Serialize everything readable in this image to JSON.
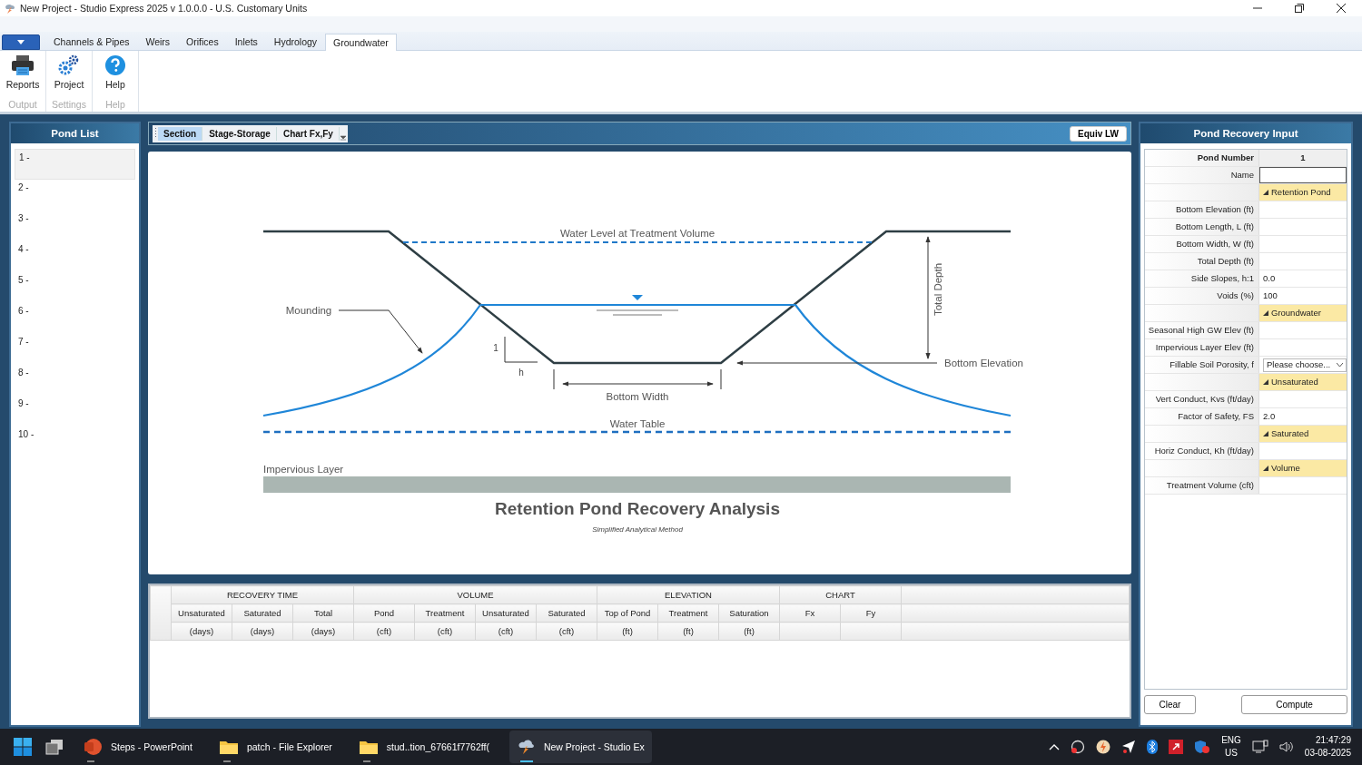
{
  "window": {
    "title": "New Project - Studio Express 2025 v 1.0.0.0 - U.S. Customary Units"
  },
  "ribbon_tabs": [
    {
      "label": "Channels & Pipes",
      "selected": false
    },
    {
      "label": "Weirs",
      "selected": false
    },
    {
      "label": "Orifices",
      "selected": false
    },
    {
      "label": "Inlets",
      "selected": false
    },
    {
      "label": "Hydrology",
      "selected": false
    },
    {
      "label": "Groundwater",
      "selected": true
    }
  ],
  "ribbon_groups": [
    {
      "label": "Output",
      "buttons": [
        {
          "label": "Reports",
          "kind": "printer"
        }
      ]
    },
    {
      "label": "Settings",
      "buttons": [
        {
          "label": "Project",
          "kind": "gears"
        }
      ]
    },
    {
      "label": "Help",
      "buttons": [
        {
          "label": "Help",
          "kind": "help"
        }
      ]
    }
  ],
  "pond_list": {
    "title": "Pond List",
    "items": [
      {
        "label": "1 -",
        "selected": true
      },
      {
        "label": "2 -",
        "selected": false
      },
      {
        "label": "3 -",
        "selected": false
      },
      {
        "label": "4 -",
        "selected": false
      },
      {
        "label": "5 -",
        "selected": false
      },
      {
        "label": "6 -",
        "selected": false
      },
      {
        "label": "7 -",
        "selected": false
      },
      {
        "label": "8 -",
        "selected": false
      },
      {
        "label": "9 -",
        "selected": false
      },
      {
        "label": "10 -",
        "selected": false
      }
    ]
  },
  "view_tabs": [
    {
      "label": "Section",
      "selected": true
    },
    {
      "label": "Stage-Storage",
      "selected": false
    },
    {
      "label": "Chart Fx,Fy",
      "selected": false
    }
  ],
  "equiv_button": "Equiv LW",
  "diagram": {
    "water_level": "Water Level at Treatment Volume",
    "mounding": "Mounding",
    "slope_v": "1",
    "slope_h": "h",
    "bottom_width": "Bottom Width",
    "total_depth": "Total Depth",
    "bottom_elevation": "Bottom Elevation",
    "water_table": "Water Table",
    "impervious": "Impervious Layer",
    "title": "Retention Pond Recovery Analysis",
    "subtitle": "Simplified Analytical Method"
  },
  "results_table": {
    "groups": [
      {
        "label": "RECOVERY TIME",
        "columns": [
          {
            "label": "Unsaturated",
            "unit": "(days)"
          },
          {
            "label": "Saturated",
            "unit": "(days)"
          },
          {
            "label": "Total",
            "unit": "(days)"
          }
        ]
      },
      {
        "label": "VOLUME",
        "columns": [
          {
            "label": "Pond",
            "unit": "(cft)"
          },
          {
            "label": "Treatment",
            "unit": "(cft)"
          },
          {
            "label": "Unsaturated",
            "unit": "(cft)"
          },
          {
            "label": "Saturated",
            "unit": "(cft)"
          }
        ]
      },
      {
        "label": "ELEVATION",
        "columns": [
          {
            "label": "Top of Pond",
            "unit": "(ft)"
          },
          {
            "label": "Treatment",
            "unit": "(ft)"
          },
          {
            "label": "Saturation",
            "unit": "(ft)"
          }
        ]
      },
      {
        "label": "CHART",
        "columns": [
          {
            "label": "Fx"
          },
          {
            "label": "Fy"
          }
        ]
      }
    ]
  },
  "input_panel": {
    "title": "Pond Recovery Input",
    "rows": [
      {
        "kind": "header",
        "label": "Pond Number",
        "value": "1"
      },
      {
        "kind": "input",
        "label": "Name"
      },
      {
        "kind": "section",
        "value": "Retention Pond"
      },
      {
        "kind": "field",
        "label": "Bottom Elevation (ft)"
      },
      {
        "kind": "field",
        "label": "Bottom Length, L (ft)"
      },
      {
        "kind": "field",
        "label": "Bottom Width, W (ft)"
      },
      {
        "kind": "field",
        "label": "Total Depth (ft)"
      },
      {
        "kind": "field",
        "label": "Side Slopes, h:1",
        "value": "0.0"
      },
      {
        "kind": "field",
        "label": "Voids (%)",
        "value": "100"
      },
      {
        "kind": "section",
        "value": "Groundwater"
      },
      {
        "kind": "field",
        "label": "Seasonal High GW Elev (ft)"
      },
      {
        "kind": "field",
        "label": "Impervious Layer Elev (ft)"
      },
      {
        "kind": "dropdown",
        "label": "Fillable Soil Porosity, f",
        "value": "Please choose..."
      },
      {
        "kind": "section",
        "value": "Unsaturated"
      },
      {
        "kind": "field",
        "label": "Vert Conduct, Kvs (ft/day)"
      },
      {
        "kind": "field",
        "label": "Factor of Safety, FS",
        "value": "2.0"
      },
      {
        "kind": "section",
        "value": "Saturated"
      },
      {
        "kind": "field",
        "label": "Horiz Conduct, Kh (ft/day)"
      },
      {
        "kind": "section",
        "value": "Volume"
      },
      {
        "kind": "field",
        "label": "Treatment Volume (cft)"
      }
    ],
    "buttons": [
      "Clear",
      "Compute"
    ]
  },
  "taskbar": {
    "items": [
      {
        "label": "Steps - PowerPoint",
        "kind": "ppt",
        "active": false
      },
      {
        "label": "patch - File Explorer",
        "kind": "folder",
        "active": false
      },
      {
        "label": "stud..tion_67661f7762ff(",
        "kind": "folder",
        "active": false
      },
      {
        "label": "New Project - Studio Ex",
        "kind": "app",
        "active": true
      }
    ],
    "language": "ENG",
    "region": "US",
    "time": "21:47:29",
    "date": "03-08-2025"
  }
}
